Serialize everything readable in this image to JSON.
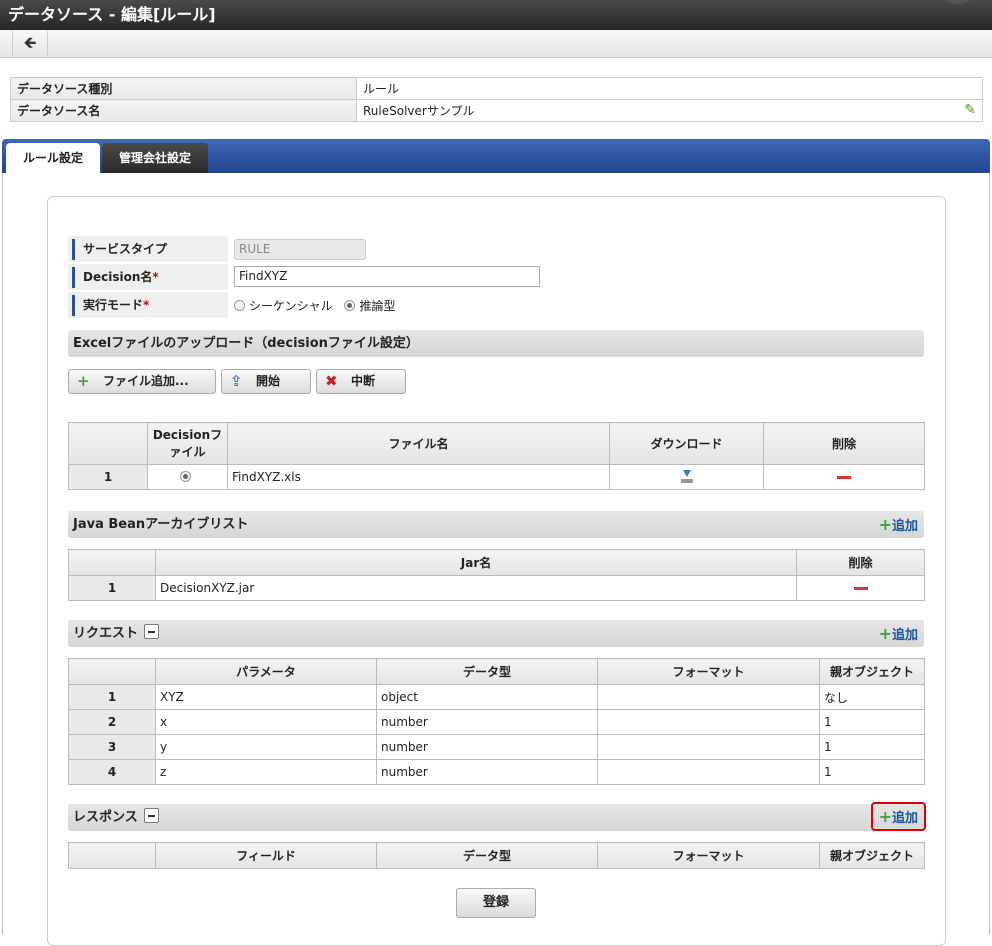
{
  "window": {
    "title": "データソース - 編集[ルール]"
  },
  "toolbar": {
    "back_icon": "arrow-left-icon",
    "back_glyph": "🡸"
  },
  "info": {
    "rows": [
      {
        "label": "データソース種別",
        "value": "ルール"
      },
      {
        "label": "データソース名",
        "value": "RuleSolverサンプル"
      }
    ],
    "edit_icon": "pencil-icon"
  },
  "tabs": [
    {
      "label": "ルール設定",
      "active": true
    },
    {
      "label": "管理会社設定",
      "active": false
    }
  ],
  "form": {
    "service_type": {
      "label": "サービスタイプ",
      "value": "RULE"
    },
    "decision_name": {
      "label": "Decision名",
      "required_mark": "*",
      "value": "FindXYZ"
    },
    "exec_mode": {
      "label": "実行モード",
      "required_mark": "*",
      "options": [
        {
          "label": "シーケンシャル",
          "selected": false
        },
        {
          "label": "推論型",
          "selected": true
        }
      ]
    }
  },
  "excel_section": {
    "title": "Excelファイルのアップロード（decisionファイル設定）",
    "buttons": [
      {
        "label": "ファイル追加...",
        "icon": "plus-icon"
      },
      {
        "label": "開始",
        "icon": "upload-icon"
      },
      {
        "label": "中断",
        "icon": "cancel-icon"
      }
    ],
    "table": {
      "headers": [
        "",
        "Decisionファイル",
        "ファイル名",
        "ダウンロード",
        "削除"
      ],
      "rows": [
        {
          "no": "1",
          "selected": true,
          "file": "FindXYZ.xls"
        }
      ]
    }
  },
  "jar_section": {
    "title": "Java Beanアーカイブリスト",
    "add_label": "追加",
    "table": {
      "headers": [
        "",
        "Jar名",
        "削除"
      ],
      "rows": [
        {
          "no": "1",
          "name": "DecisionXYZ.jar"
        }
      ]
    }
  },
  "request_section": {
    "title": "リクエスト",
    "add_label": "追加",
    "table": {
      "headers": [
        "",
        "パラメータ",
        "データ型",
        "フォーマット",
        "親オブジェクト"
      ],
      "rows": [
        {
          "no": "1",
          "param": "XYZ",
          "type": "object",
          "format": "",
          "parent": "なし"
        },
        {
          "no": "2",
          "param": "x",
          "type": "number",
          "format": "",
          "parent": "1"
        },
        {
          "no": "3",
          "param": "y",
          "type": "number",
          "format": "",
          "parent": "1"
        },
        {
          "no": "4",
          "param": "z",
          "type": "number",
          "format": "",
          "parent": "1"
        }
      ]
    }
  },
  "response_section": {
    "title": "レスポンス",
    "add_label": "追加",
    "table": {
      "headers": [
        "",
        "フィールド",
        "データ型",
        "フォーマット",
        "親オブジェクト"
      ]
    }
  },
  "submit_label": "登録",
  "colors": {
    "tab_bar": "#2f5aa6",
    "highlight": "#dd0000",
    "add_link": "#1a56a0",
    "plus": "#3ba53b",
    "delete": "#dd3333"
  }
}
